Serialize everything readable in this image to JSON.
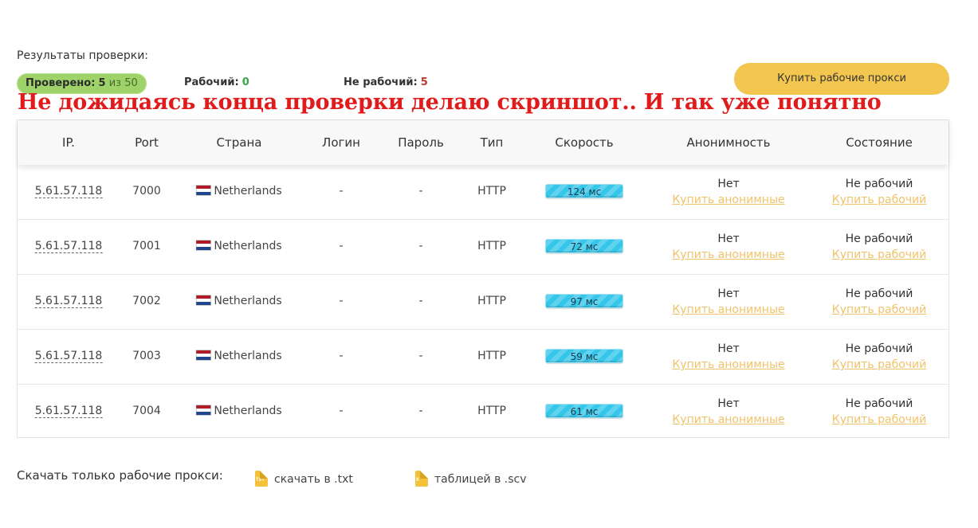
{
  "summary": {
    "title": "Результаты проверки:",
    "checked_label": "Проверено:",
    "checked_count": "5",
    "checked_of": "из 50",
    "working_label": "Рабочий:",
    "working_count": "0",
    "not_working_label": "Не рабочий:",
    "not_working_count": "5"
  },
  "buy_button": {
    "label": "Купить рабочие прокси"
  },
  "overlay_caption": "Не дожидаясь конца проверки делаю скриншот.. И так уже понятно",
  "table": {
    "headers": [
      "IP.",
      "Port",
      "Страна",
      "Логин",
      "Пароль",
      "Тип",
      "Скорость",
      "Анонимность",
      "Состояние"
    ],
    "rows": [
      {
        "ip": "5.61.57.118",
        "port": "7000",
        "country": "Netherlands",
        "login": "-",
        "password": "-",
        "type": "HTTP",
        "speed": "124 мс",
        "anonymity": "Нет",
        "anonymity_link": "Купить анонимные",
        "state": "Не рабочий",
        "state_link": "Купить рабочий"
      },
      {
        "ip": "5.61.57.118",
        "port": "7001",
        "country": "Netherlands",
        "login": "-",
        "password": "-",
        "type": "HTTP",
        "speed": "72 мс",
        "anonymity": "Нет",
        "anonymity_link": "Купить анонимные",
        "state": "Не рабочий",
        "state_link": "Купить рабочий"
      },
      {
        "ip": "5.61.57.118",
        "port": "7002",
        "country": "Netherlands",
        "login": "-",
        "password": "-",
        "type": "HTTP",
        "speed": "97 мс",
        "anonymity": "Нет",
        "anonymity_link": "Купить анонимные",
        "state": "Не рабочий",
        "state_link": "Купить рабочий"
      },
      {
        "ip": "5.61.57.118",
        "port": "7003",
        "country": "Netherlands",
        "login": "-",
        "password": "-",
        "type": "HTTP",
        "speed": "59 мс",
        "anonymity": "Нет",
        "anonymity_link": "Купить анонимные",
        "state": "Не рабочий",
        "state_link": "Купить рабочий"
      },
      {
        "ip": "5.61.57.118",
        "port": "7004",
        "country": "Netherlands",
        "login": "-",
        "password": "-",
        "type": "HTTP",
        "speed": "61 мс",
        "anonymity": "Нет",
        "anonymity_link": "Купить анонимные",
        "state": "Не рабочий",
        "state_link": "Купить рабочий"
      }
    ]
  },
  "download": {
    "label": "Скачать только рабочие прокси:",
    "txt_label": "скачать в .txt",
    "csv_label": "таблицей в .scv"
  },
  "icons": {
    "flag": "netherlands-flag-icon",
    "txt": "txt-file-icon",
    "csv": "csv-file-icon"
  },
  "colors": {
    "accent_yellow": "#f2c64f",
    "pill_green": "#9ed36a",
    "working_green": "#36a745",
    "not_working_red": "#c0392b",
    "speed_blue": "#35c7ea",
    "link_yellow": "#f0c36a",
    "caption_red": "#e11b1b"
  }
}
